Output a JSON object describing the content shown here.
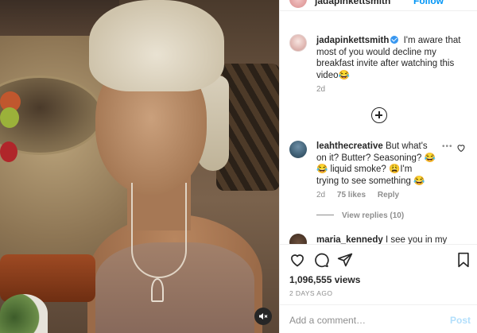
{
  "post": {
    "author": "jadapinkettsmith",
    "follow_label": "Follow",
    "caption": "I'm aware that most of you would decline my breakfast invite after watching this video😂",
    "caption_time": "2d"
  },
  "comments": [
    {
      "username": "leahthecreative",
      "text": "But what's on it? Butter? Seasoning? 😂😂 liquid smoke? 😩I'm trying to see something 😂",
      "time": "2d",
      "likes": "75 likes",
      "reply_label": "Reply",
      "view_replies": "View replies (10)"
    },
    {
      "username": "maria_kennedy",
      "text": "I see you in my"
    }
  ],
  "actions": {
    "views": "1,096,555 views",
    "posted": "2 DAYS AGO",
    "comment_placeholder": "Add a comment…",
    "post_label": "Post"
  },
  "icons": {
    "mute": "speaker-muted-icon",
    "like": "heart-icon",
    "comment": "comment-bubble-icon",
    "share": "paper-plane-icon",
    "save": "bookmark-icon",
    "more": "plus-circle-icon",
    "verified": "verified-badge-icon"
  },
  "colors": {
    "verified": "#3897f0",
    "link": "#0095f6",
    "post_disabled": "#b2dffc",
    "muted_text": "#8e8e8e"
  }
}
